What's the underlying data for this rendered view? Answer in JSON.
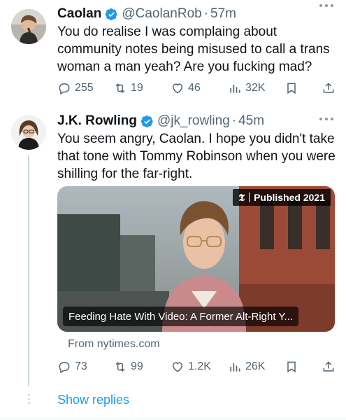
{
  "tweets": [
    {
      "author_name": "Caolan",
      "author_handle": "@CaolanRob",
      "separator": "·",
      "time": "57m",
      "text": "You do realise I was complaing about community notes being misused to call a trans woman a man yeah? Are you fucking mad?",
      "stats": {
        "replies": "255",
        "reposts": "19",
        "likes": "46",
        "views": "32K"
      }
    },
    {
      "author_name": "J.K. Rowling",
      "author_handle": "@jk_rowling",
      "separator": "·",
      "time": "45m",
      "text": "You seem angry, Caolan. I hope you didn't take that tone with Tommy Robinson when you were shilling for the far-right.",
      "card": {
        "badge_logo": "𝕿",
        "badge_text": "Published 2021",
        "title": "Feeding Hate With Video: A Former Alt-Right Y...",
        "source": "From nytimes.com"
      },
      "stats": {
        "replies": "73",
        "reposts": "99",
        "likes": "1.2K",
        "views": "26K"
      }
    }
  ],
  "show_replies": "Show replies",
  "colors": {
    "accent": "#1d9bf0",
    "text": "#0f1419",
    "muted": "#536471",
    "thread_line": "#cfd9de"
  },
  "icons": [
    "verified-badge-icon",
    "more-icon",
    "reply-icon",
    "repost-icon",
    "like-icon",
    "views-icon",
    "bookmark-icon",
    "share-icon"
  ]
}
